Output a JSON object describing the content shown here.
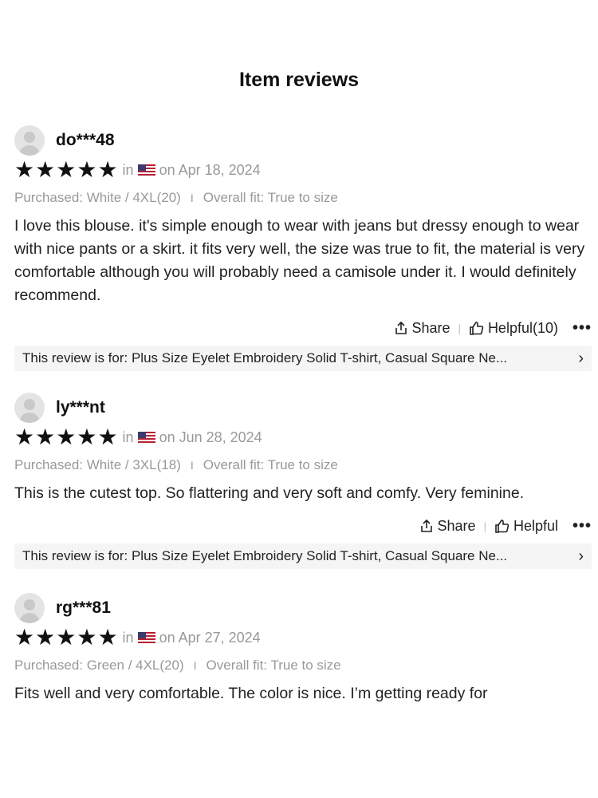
{
  "title": "Item reviews",
  "in_label": "in",
  "actions": {
    "share": "Share",
    "more": "•••"
  },
  "reviews": [
    {
      "user": "do***48",
      "date": "on Apr 18, 2024",
      "purchased": "Purchased: White / 4XL(20)",
      "fit": "Overall fit: True to size",
      "text": "I love this blouse. it's simple enough to wear with jeans but dressy enough to wear with nice pants or a skirt. it fits very well, the size was true to fit, the material is very comfortable although you will probably need a camisole under it. I would definitely recommend.",
      "helpful": "Helpful(10)",
      "review_for": "This review is for: Plus Size Eyelet Embroidery Solid T-shirt, Casual Square Ne..."
    },
    {
      "user": "ly***nt",
      "date": "on Jun 28, 2024",
      "purchased": "Purchased: White / 3XL(18)",
      "fit": "Overall fit: True to size",
      "text": "This is the cutest top. So flattering and very soft and comfy. Very feminine.",
      "helpful": "Helpful",
      "review_for": "This review is for: Plus Size Eyelet Embroidery Solid T-shirt, Casual Square Ne..."
    },
    {
      "user": "rg***81",
      "date": "on Apr 27, 2024",
      "purchased": "Purchased: Green / 4XL(20)",
      "fit": "Overall fit: True to size",
      "text": "Fits well and very comfortable. The color is nice. I’m getting ready for"
    }
  ]
}
